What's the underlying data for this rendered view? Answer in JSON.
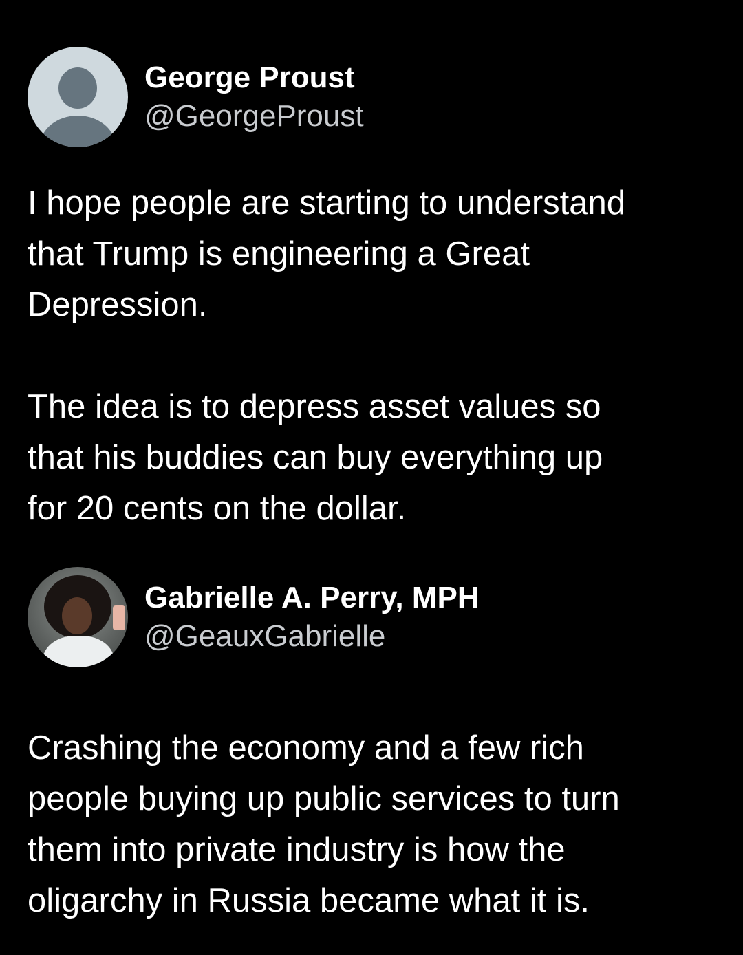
{
  "posts": [
    {
      "display_name": "George Proust",
      "handle": "@GeorgeProust",
      "avatar_icon": "default-user-avatar",
      "text": "I hope people are starting to understand\nthat Trump is engineering a Great\nDepression.\n\nThe idea is to depress asset values so\nthat his buddies can buy everything up\nfor 20 cents on the dollar."
    },
    {
      "display_name": "Gabrielle A. Perry, MPH",
      "handle": "@GeauxGabrielle",
      "avatar_icon": "profile-photo",
      "text": "Crashing the economy and a few rich\npeople buying up public services to turn\nthem into private industry is how the\noligarchy in Russia became what it is."
    }
  ],
  "colors": {
    "background": "#000000",
    "primary_text": "#ffffff",
    "secondary_text": "#c9ccd0",
    "default_avatar_bg": "#cfd9de",
    "default_avatar_fg": "#66757f"
  }
}
